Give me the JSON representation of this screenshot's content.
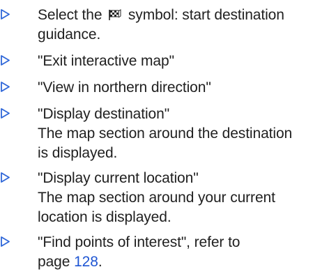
{
  "marker_color": "#2f67d8",
  "link_color": "#1f56d3",
  "items": [
    {
      "icon": "triangle-right-icon",
      "line1_before": "Select the",
      "line1_symbol": "checkered-flag-icon",
      "line1_after": "symbol: start destination",
      "line2": "guidance."
    },
    {
      "icon": "triangle-right-icon",
      "text": "\"Exit interactive map\""
    },
    {
      "icon": "triangle-right-icon",
      "text": "\"View in northern direction\""
    },
    {
      "icon": "triangle-right-icon",
      "text": "\"Display destination\"",
      "detail_line1": "The map section around the destination",
      "detail_line2": "is displayed."
    },
    {
      "icon": "triangle-right-icon",
      "text": "\"Display current location\"",
      "detail_line1": "The map section around your current",
      "detail_line2": "location is displayed."
    },
    {
      "icon": "triangle-right-icon",
      "line1": "\"Find points of interest\", refer to",
      "line2_before": "page",
      "page_number": "128",
      "line2_after": "."
    }
  ]
}
